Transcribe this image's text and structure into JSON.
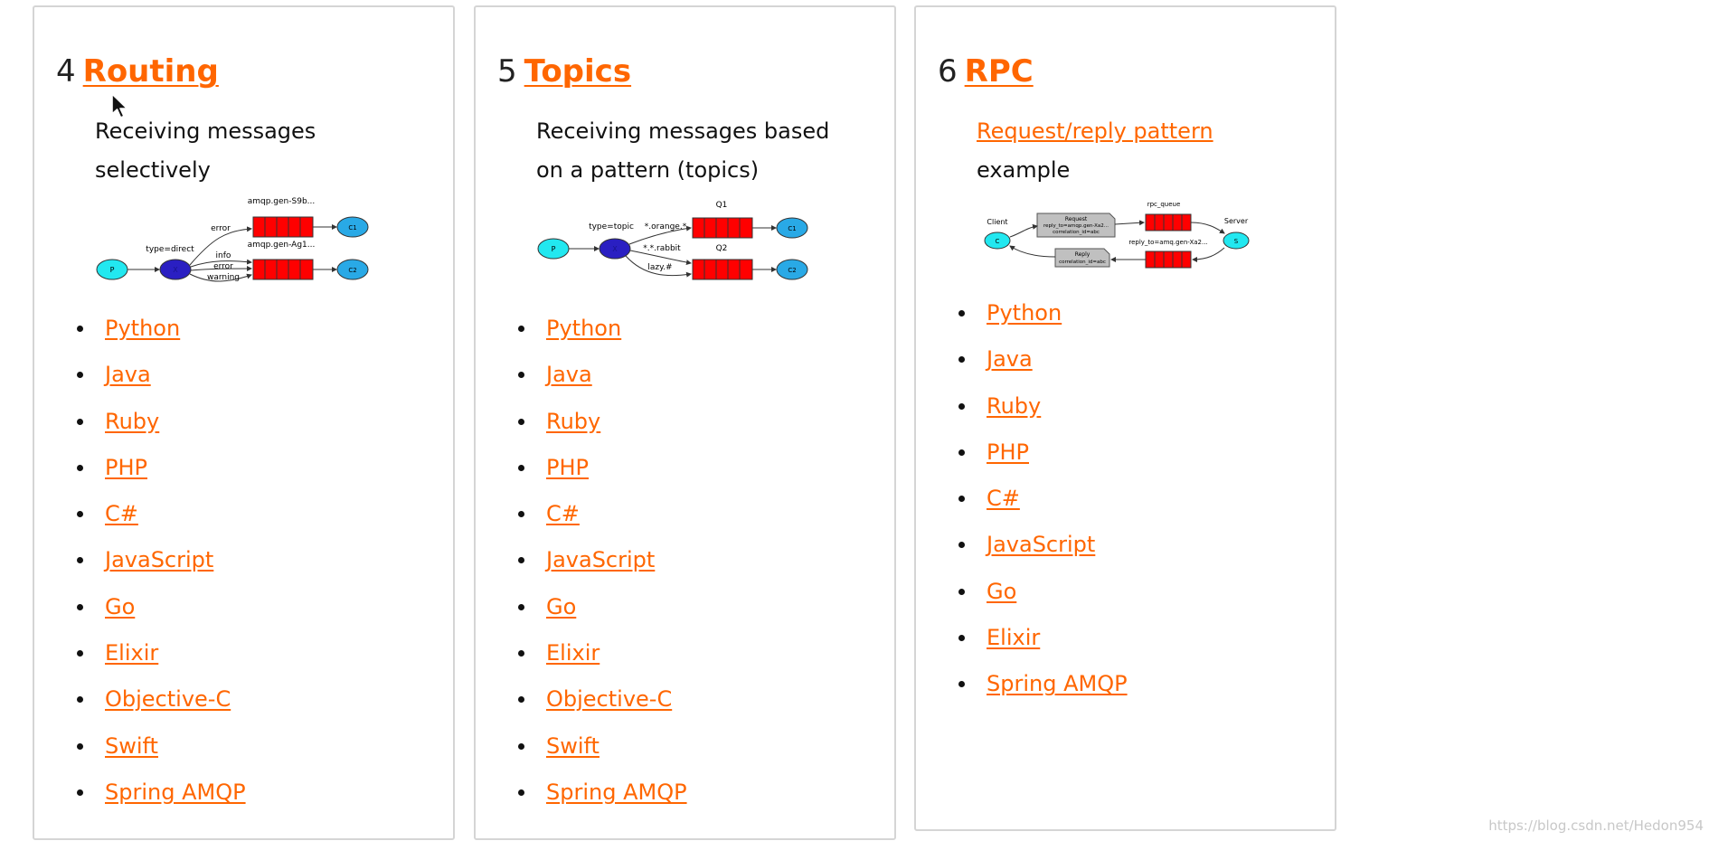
{
  "cards": [
    {
      "number": "4",
      "title": "Routing",
      "description": "Receiving messages selectively",
      "diagram": {
        "producer": "P",
        "exchange_label": "type=direct",
        "exchange": "X",
        "queues": [
          "amqp.gen-S9b...",
          "amqp.gen-Ag1..."
        ],
        "bindings": [
          "error",
          "info",
          "error",
          "warning"
        ],
        "consumers": [
          "C1",
          "C2"
        ]
      },
      "links": [
        "Python",
        "Java",
        "Ruby",
        "PHP",
        "C#",
        "JavaScript",
        "Go",
        "Elixir",
        "Objective-C",
        "Swift",
        "Spring AMQP"
      ]
    },
    {
      "number": "5",
      "title": "Topics",
      "description": "Receiving messages based on a pattern (topics)",
      "diagram": {
        "producer": "P",
        "exchange_label": "type=topic",
        "exchange": "X",
        "queues": [
          "Q1",
          "Q2"
        ],
        "bindings": [
          "*.orange.*",
          "*.*.rabbit",
          "lazy.#"
        ],
        "consumers": [
          "C1",
          "C2"
        ]
      },
      "links": [
        "Python",
        "Java",
        "Ruby",
        "PHP",
        "C#",
        "JavaScript",
        "Go",
        "Elixir",
        "Objective-C",
        "Swift",
        "Spring AMQP"
      ]
    },
    {
      "number": "6",
      "title": "RPC",
      "description_link": "Request/reply pattern",
      "description_rest": "example",
      "diagram": {
        "client_label": "Client",
        "client": "C",
        "server_label": "Server",
        "server": "S",
        "request_lines": [
          "Request",
          "reply_to=amqp.gen-Xa2...",
          "correlation_id=abc"
        ],
        "reply_lines": [
          "Reply",
          "correlation_id=abc"
        ],
        "rpc_queue": "rpc_queue",
        "reply_queue": "reply_to=amq.gen-Xa2..."
      },
      "links": [
        "Python",
        "Java",
        "Ruby",
        "PHP",
        "C#",
        "JavaScript",
        "Go",
        "Elixir",
        "Spring AMQP"
      ]
    }
  ],
  "watermark": "https://blog.csdn.net/Hedon954",
  "colors": {
    "accent": "#ff6600",
    "queue": "#ff0000",
    "consumer": "#29a9e6",
    "producer": "#22e8f0",
    "exchange": "#2a1fc2",
    "card_border": "#d5d5d5"
  }
}
